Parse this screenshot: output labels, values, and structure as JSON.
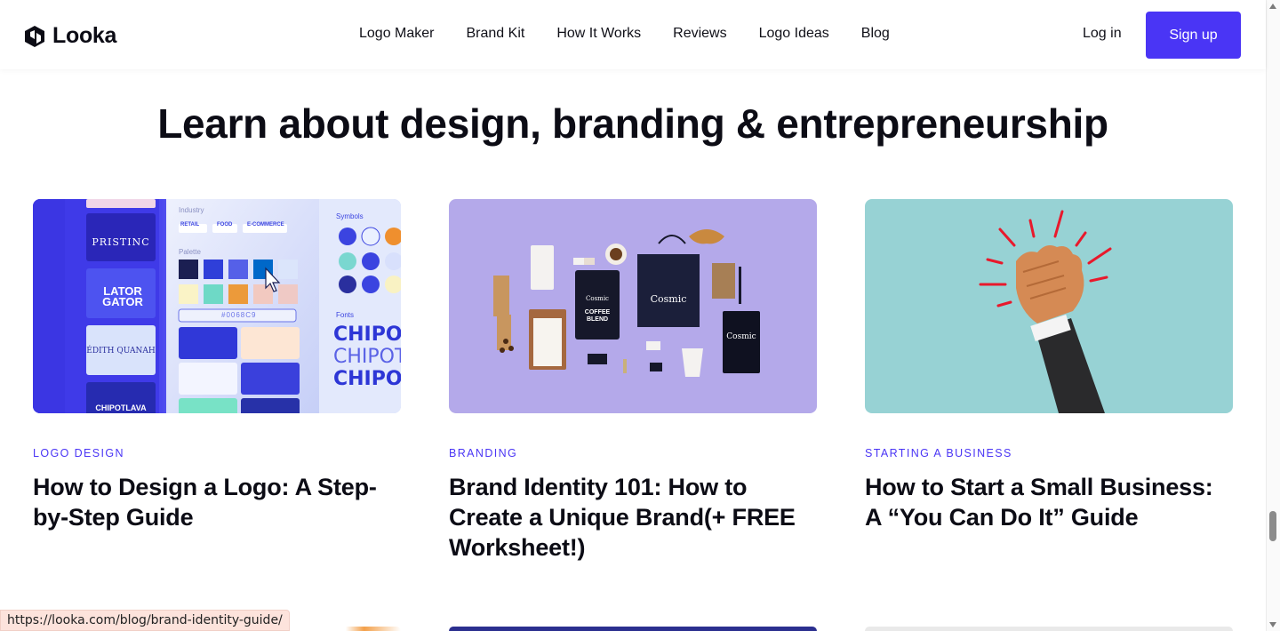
{
  "brand": {
    "name": "Looka"
  },
  "nav": {
    "items": [
      "Logo Maker",
      "Brand Kit",
      "How It Works",
      "Reviews",
      "Logo Ideas",
      "Blog"
    ],
    "login": "Log in",
    "signup": "Sign up"
  },
  "page": {
    "title": "Learn about design, branding & entrepreneurship"
  },
  "cards": [
    {
      "category": "LOGO DESIGN",
      "title": "How to Design a Logo: A Step-by-Step Guide",
      "image": {
        "industry_label": "Industry",
        "industry_tags": [
          "RETAIL",
          "FOOD",
          "E-COMMERCE"
        ],
        "palette_label": "Palette",
        "hex_value": "#0068C9",
        "symbols_label": "Symbols",
        "fonts_label": "Fonts",
        "font_sample": "CHIPOTL",
        "logo_names": [
          "PRISTINC",
          "LATOR GATOR",
          "ÉDITH QUANAH",
          "CHIPOTLAVA"
        ]
      }
    },
    {
      "category": "BRANDING",
      "title": "Brand Identity 101: How to Create a Unique Brand(+ FREE Worksheet!)",
      "image": {
        "brand_name": "Cosmic",
        "product_text": "COFFEE BLEND"
      }
    },
    {
      "category": "STARTING A BUSINESS",
      "title": "How to Start a Small Business: A “You Can Do It” Guide",
      "image": {}
    }
  ],
  "status_url": "https://looka.com/blog/brand-identity-guide/",
  "colors": {
    "accent": "#4a35f5",
    "text": "#0c0c15"
  },
  "icons": {
    "logo": "looka-hexagon-icon",
    "scroll_up": "chevron-up-icon",
    "scroll_down": "chevron-down-icon",
    "cursor": "mouse-pointer-icon"
  }
}
